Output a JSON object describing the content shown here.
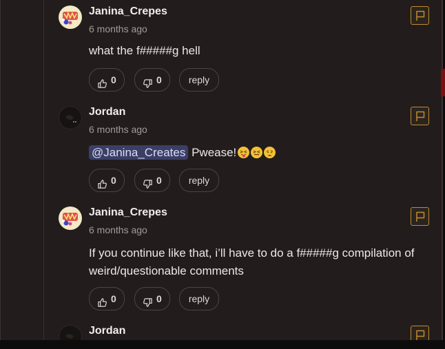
{
  "comments": [
    {
      "username": "Janina_Crepes",
      "timestamp": "6 months ago",
      "text": "what the f#####g hell",
      "likes": "0",
      "dislikes": "0",
      "reply_label": "reply",
      "avatar": "crepes-avatar"
    },
    {
      "username": "Jordan",
      "timestamp": "6 months ago",
      "mention": "@Janina_Creates",
      "text": "Pwease!",
      "emojis": [
        "squinting-tongue-emoji",
        "confounded-emoji",
        "weary-emoji"
      ],
      "likes": "0",
      "dislikes": "0",
      "reply_label": "reply",
      "avatar": "jordan-avatar"
    },
    {
      "username": "Janina_Crepes",
      "timestamp": "6 months ago",
      "text": "If you continue like that, i’ll have to do a f#####g compilation of weird/questionable comments",
      "likes": "0",
      "dislikes": "0",
      "reply_label": "reply",
      "avatar": "crepes-avatar"
    },
    {
      "username": "Jordan",
      "avatar": "jordan-avatar"
    }
  ],
  "icons": {
    "like": "thumbs-up-icon",
    "dislike": "thumbs-down-icon",
    "flag": "flag-icon"
  },
  "colors": {
    "background": "#221d1c",
    "flag_accent": "#c48a2c",
    "mention_bg": "#3b3f66"
  }
}
